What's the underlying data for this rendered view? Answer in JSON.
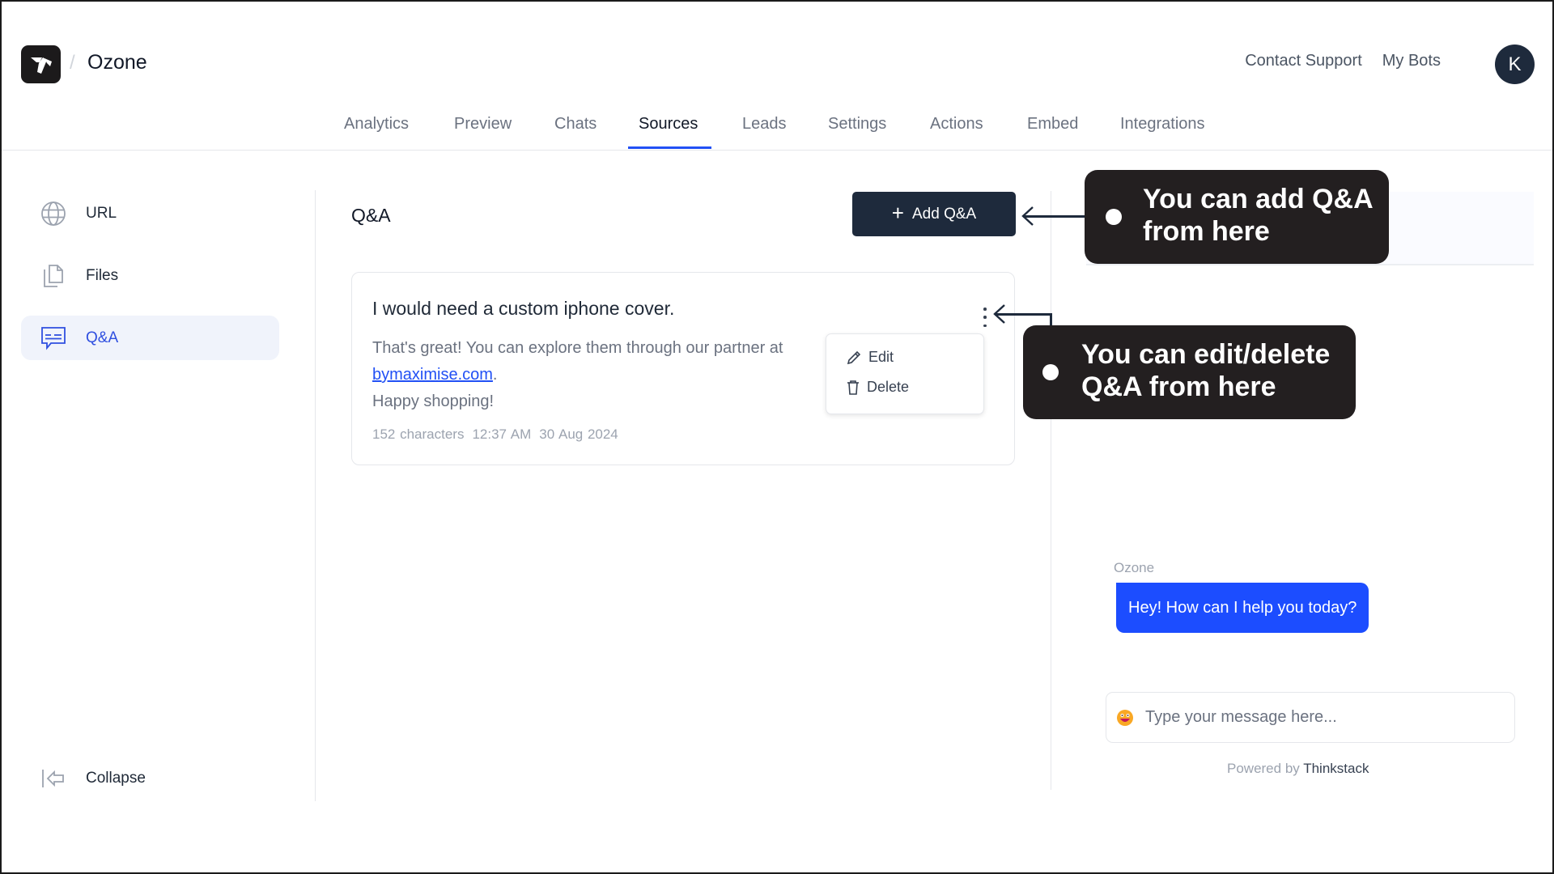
{
  "header": {
    "bot_name": "Ozone",
    "breadcrumb_separator": "/",
    "contact_support": "Contact Support",
    "my_bots": "My Bots",
    "avatar_initial": "K"
  },
  "tabs": [
    {
      "label": "Analytics",
      "active": false
    },
    {
      "label": "Preview",
      "active": false
    },
    {
      "label": "Chats",
      "active": false
    },
    {
      "label": "Sources",
      "active": true
    },
    {
      "label": "Leads",
      "active": false
    },
    {
      "label": "Settings",
      "active": false
    },
    {
      "label": "Actions",
      "active": false
    },
    {
      "label": "Embed",
      "active": false
    },
    {
      "label": "Integrations",
      "active": false
    }
  ],
  "sidebar": {
    "items": [
      {
        "label": "URL",
        "icon": "globe-icon",
        "active": false
      },
      {
        "label": "Files",
        "icon": "files-icon",
        "active": false
      },
      {
        "label": "Q&A",
        "icon": "qa-message-icon",
        "active": true
      }
    ],
    "collapse_label": "Collapse"
  },
  "main": {
    "title": "Q&A",
    "add_button_label": "Add Q&A",
    "qa_items": [
      {
        "question": "I would need a custom iphone cover.",
        "answer_prefix": "That's great! You can explore them through our partner at ",
        "answer_link": "bymaximise.com",
        "answer_suffix": ".",
        "answer_line3": "Happy shopping!",
        "characters": "152 characters",
        "time": "12:37 AM",
        "date": "30 Aug 2024"
      }
    ],
    "menu": {
      "edit_label": "Edit",
      "delete_label": "Delete"
    }
  },
  "chat_preview": {
    "sender": "Ozone",
    "greeting": "Hey! How can I help you today?",
    "input_placeholder": "Type your message here...",
    "powered_by_prefix": "Powered by",
    "powered_by_brand": "Thinkstack"
  },
  "callouts": [
    {
      "text": "You can add Q&A from here"
    },
    {
      "text": "You can edit/delete Q&A from here"
    }
  ],
  "colors": {
    "accent": "#2150f5",
    "dark_button": "#1e2a3c",
    "chat_bubble": "#1c4dff",
    "callout_bg": "#231f20",
    "active_sidebar_bg": "#f0f3fb"
  }
}
